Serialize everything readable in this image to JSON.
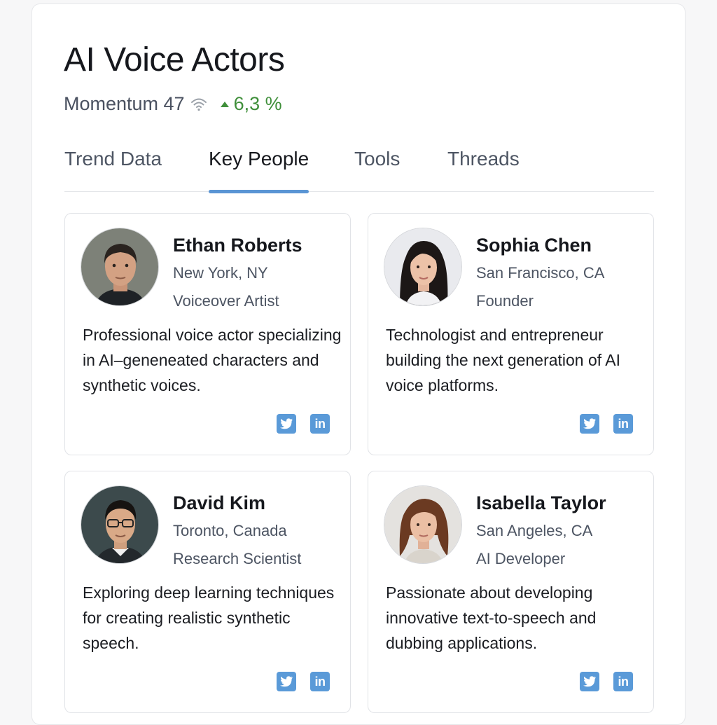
{
  "header": {
    "title": "AI Voice Actors",
    "momentum_label": "Momentum 47",
    "momentum_change": "6,3 %",
    "signal_icon": "signal-icon",
    "change_icon": "trend-up-icon"
  },
  "tabs": [
    {
      "label": "Trend Data",
      "active": false
    },
    {
      "label": "Key People",
      "active": true
    },
    {
      "label": "Tools",
      "active": false
    },
    {
      "label": "Threads",
      "active": false
    }
  ],
  "people": [
    {
      "name": "Ethan Roberts",
      "location": "New York, NY",
      "role": "Voiceover Artist",
      "bio": "Professional voice actor specializing in AI–geneneated characters and synthetic voices.",
      "social": [
        "twitter-icon",
        "linkedin-icon"
      ]
    },
    {
      "name": "Sophia Chen",
      "location": "San Francisco, CA",
      "role": "Founder",
      "bio": "Technologist and entrepreneur building the next generation of AI voice platforms.",
      "social": [
        "twitter-icon",
        "linkedin-icon"
      ]
    },
    {
      "name": "David Kim",
      "location": "Toronto, Canada",
      "role": "Research Scientist",
      "bio": "Exploring deep learning techniques for creating realistic synthetic speech.",
      "social": [
        "twitter-icon",
        "linkedin-icon"
      ]
    },
    {
      "name": "Isabella Taylor",
      "location": "San Angeles, CA",
      "role": "AI Developer",
      "bio": "Passionate about developing innovative text-to-speech and dubbing applications.",
      "social": [
        "twitter-icon",
        "linkedin-icon"
      ]
    }
  ],
  "colors": {
    "accent": "#5a95d4",
    "positive": "#3f8f3a",
    "social": "#5a9ad8"
  }
}
